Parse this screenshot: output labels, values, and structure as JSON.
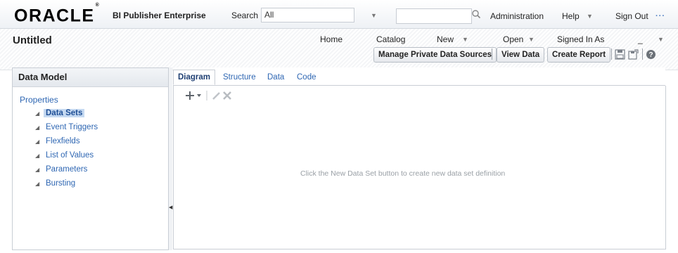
{
  "header": {
    "logo_text": "ORACLE",
    "logo_mark": "®",
    "product": "BI Publisher Enterprise",
    "search_label": "Search",
    "search_scope": "All",
    "search_value": "",
    "nav": [
      "Administration",
      "Help",
      "Sign Out"
    ]
  },
  "subheader": {
    "title": "Untitled",
    "nav": [
      "Home",
      "Catalog",
      "New",
      "Open",
      "Signed In As"
    ],
    "signed_in_user": "_",
    "buttons": {
      "manage_private": "Manage Private Data Sources",
      "view_data": "View Data",
      "create_report": "Create Report"
    }
  },
  "left_panel": {
    "title": "Data Model",
    "properties_label": "Properties",
    "items": [
      {
        "label": "Data Sets",
        "selected": true
      },
      {
        "label": "Event Triggers",
        "selected": false
      },
      {
        "label": "Flexfields",
        "selected": false
      },
      {
        "label": "List of Values",
        "selected": false
      },
      {
        "label": "Parameters",
        "selected": false
      },
      {
        "label": "Bursting",
        "selected": false
      }
    ]
  },
  "right_panel": {
    "tabs": [
      "Diagram",
      "Structure",
      "Data",
      "Code"
    ],
    "active_tab": "Diagram",
    "empty_message": "Click the New Data Set button to create new data set definition"
  },
  "colors": {
    "link": "#2f67b3",
    "selected_bg": "#c5d9f1",
    "border": "#c9ced5"
  }
}
